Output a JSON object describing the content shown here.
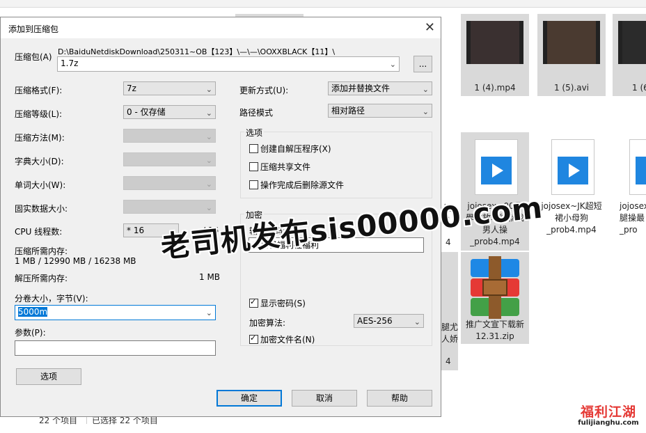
{
  "explorer": {
    "tiles_row1": [
      {
        "caption": "1 (4).mp4"
      },
      {
        "caption": "1 (5).avi"
      },
      {
        "caption": "1 (6"
      }
    ],
    "tiles_row2": [
      {
        "caption": "jojosex~00后學妹放學後就找男人操_prob4.mp4"
      },
      {
        "caption": "jojosex~JK超短裙小母狗_prob4.mp4"
      },
      {
        "caption": "jojosex~腿操最_pro"
      }
    ],
    "partial_captions": [
      "然",
      "的",
      "4",
      "腿尤",
      "人娇",
      "4"
    ],
    "archive_tile": {
      "caption": "推广文宣下载新12.31.zip"
    },
    "status": {
      "count": "22 个项目",
      "selected": "已选择 22 个项目"
    }
  },
  "dialog": {
    "title": "添加到压缩包",
    "archive_label": "压缩包(A)",
    "archive_path": "D:\\BaiduNetdiskDownload\\250311~OB【123】\\—\\—\\OOXXBLACK【11】\\",
    "archive_name": "1.7z",
    "browse_label": "...",
    "format_label": "压缩格式(F):",
    "format_value": "7z",
    "level_label": "压缩等级(L):",
    "level_value": "0 - 仅存储",
    "method_label": "压缩方法(M):",
    "dict_label": "字典大小(D):",
    "word_label": "单词大小(W):",
    "solid_label": "固实数据大小:",
    "cpu_label": "CPU 线程数:",
    "cpu_value": "* 16",
    "cpu_total": "/ 16",
    "mem_comp_label": "压缩所需内存:",
    "mem_comp_value": "1 MB / 12990 MB / 16238 MB",
    "mem_decomp_label": "解压所需内存:",
    "mem_decomp_value": "1 MB",
    "split_label": "分卷大小，字节(V):",
    "split_value": "5000m",
    "params_label": "参数(P):",
    "options_button": "选项",
    "update_label": "更新方式(U):",
    "update_value": "添加并替换文件",
    "pathmode_label": "路径模式",
    "pathmode_value": "相对路径",
    "options_group": "选项",
    "opt_sfx": "创建自解压程序(X)",
    "opt_shared": "压缩共享文件",
    "opt_delete": "操作完成后删除源文件",
    "encrypt_group": "加密",
    "password_label": "输入密码:",
    "password_value": "老司机福利社福利",
    "show_password": "显示密码(S)",
    "enc_method_label": "加密算法:",
    "enc_method_value": "AES-256",
    "encrypt_names": "加密文件名(N)",
    "ok": "确定",
    "cancel": "取消",
    "help": "帮助"
  },
  "overlay": {
    "watermark": "老司机发布sis00000.com",
    "logo_top": "福利江湖",
    "logo_bottom": "fulijianghu.com"
  }
}
